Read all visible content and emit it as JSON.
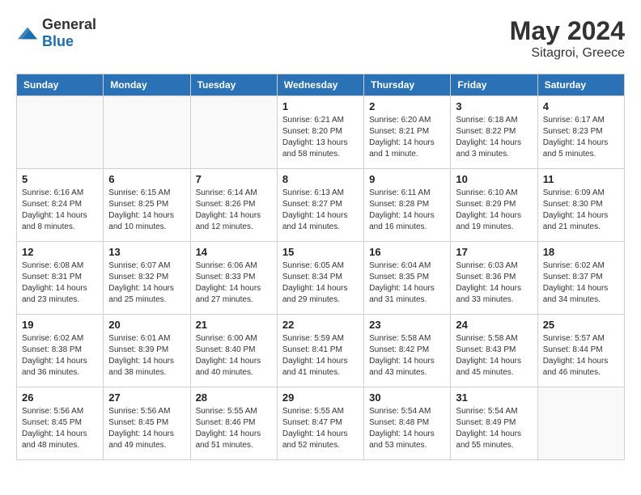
{
  "header": {
    "logo_general": "General",
    "logo_blue": "Blue",
    "month": "May 2024",
    "location": "Sitagroi, Greece"
  },
  "days_of_week": [
    "Sunday",
    "Monday",
    "Tuesday",
    "Wednesday",
    "Thursday",
    "Friday",
    "Saturday"
  ],
  "weeks": [
    [
      {
        "day": "",
        "sunrise": "",
        "sunset": "",
        "daylight": "",
        "empty": true
      },
      {
        "day": "",
        "sunrise": "",
        "sunset": "",
        "daylight": "",
        "empty": true
      },
      {
        "day": "",
        "sunrise": "",
        "sunset": "",
        "daylight": "",
        "empty": true
      },
      {
        "day": "1",
        "sunrise": "Sunrise: 6:21 AM",
        "sunset": "Sunset: 8:20 PM",
        "daylight": "Daylight: 13 hours and 58 minutes."
      },
      {
        "day": "2",
        "sunrise": "Sunrise: 6:20 AM",
        "sunset": "Sunset: 8:21 PM",
        "daylight": "Daylight: 14 hours and 1 minute."
      },
      {
        "day": "3",
        "sunrise": "Sunrise: 6:18 AM",
        "sunset": "Sunset: 8:22 PM",
        "daylight": "Daylight: 14 hours and 3 minutes."
      },
      {
        "day": "4",
        "sunrise": "Sunrise: 6:17 AM",
        "sunset": "Sunset: 8:23 PM",
        "daylight": "Daylight: 14 hours and 5 minutes."
      }
    ],
    [
      {
        "day": "5",
        "sunrise": "Sunrise: 6:16 AM",
        "sunset": "Sunset: 8:24 PM",
        "daylight": "Daylight: 14 hours and 8 minutes."
      },
      {
        "day": "6",
        "sunrise": "Sunrise: 6:15 AM",
        "sunset": "Sunset: 8:25 PM",
        "daylight": "Daylight: 14 hours and 10 minutes."
      },
      {
        "day": "7",
        "sunrise": "Sunrise: 6:14 AM",
        "sunset": "Sunset: 8:26 PM",
        "daylight": "Daylight: 14 hours and 12 minutes."
      },
      {
        "day": "8",
        "sunrise": "Sunrise: 6:13 AM",
        "sunset": "Sunset: 8:27 PM",
        "daylight": "Daylight: 14 hours and 14 minutes."
      },
      {
        "day": "9",
        "sunrise": "Sunrise: 6:11 AM",
        "sunset": "Sunset: 8:28 PM",
        "daylight": "Daylight: 14 hours and 16 minutes."
      },
      {
        "day": "10",
        "sunrise": "Sunrise: 6:10 AM",
        "sunset": "Sunset: 8:29 PM",
        "daylight": "Daylight: 14 hours and 19 minutes."
      },
      {
        "day": "11",
        "sunrise": "Sunrise: 6:09 AM",
        "sunset": "Sunset: 8:30 PM",
        "daylight": "Daylight: 14 hours and 21 minutes."
      }
    ],
    [
      {
        "day": "12",
        "sunrise": "Sunrise: 6:08 AM",
        "sunset": "Sunset: 8:31 PM",
        "daylight": "Daylight: 14 hours and 23 minutes."
      },
      {
        "day": "13",
        "sunrise": "Sunrise: 6:07 AM",
        "sunset": "Sunset: 8:32 PM",
        "daylight": "Daylight: 14 hours and 25 minutes."
      },
      {
        "day": "14",
        "sunrise": "Sunrise: 6:06 AM",
        "sunset": "Sunset: 8:33 PM",
        "daylight": "Daylight: 14 hours and 27 minutes."
      },
      {
        "day": "15",
        "sunrise": "Sunrise: 6:05 AM",
        "sunset": "Sunset: 8:34 PM",
        "daylight": "Daylight: 14 hours and 29 minutes."
      },
      {
        "day": "16",
        "sunrise": "Sunrise: 6:04 AM",
        "sunset": "Sunset: 8:35 PM",
        "daylight": "Daylight: 14 hours and 31 minutes."
      },
      {
        "day": "17",
        "sunrise": "Sunrise: 6:03 AM",
        "sunset": "Sunset: 8:36 PM",
        "daylight": "Daylight: 14 hours and 33 minutes."
      },
      {
        "day": "18",
        "sunrise": "Sunrise: 6:02 AM",
        "sunset": "Sunset: 8:37 PM",
        "daylight": "Daylight: 14 hours and 34 minutes."
      }
    ],
    [
      {
        "day": "19",
        "sunrise": "Sunrise: 6:02 AM",
        "sunset": "Sunset: 8:38 PM",
        "daylight": "Daylight: 14 hours and 36 minutes."
      },
      {
        "day": "20",
        "sunrise": "Sunrise: 6:01 AM",
        "sunset": "Sunset: 8:39 PM",
        "daylight": "Daylight: 14 hours and 38 minutes."
      },
      {
        "day": "21",
        "sunrise": "Sunrise: 6:00 AM",
        "sunset": "Sunset: 8:40 PM",
        "daylight": "Daylight: 14 hours and 40 minutes."
      },
      {
        "day": "22",
        "sunrise": "Sunrise: 5:59 AM",
        "sunset": "Sunset: 8:41 PM",
        "daylight": "Daylight: 14 hours and 41 minutes."
      },
      {
        "day": "23",
        "sunrise": "Sunrise: 5:58 AM",
        "sunset": "Sunset: 8:42 PM",
        "daylight": "Daylight: 14 hours and 43 minutes."
      },
      {
        "day": "24",
        "sunrise": "Sunrise: 5:58 AM",
        "sunset": "Sunset: 8:43 PM",
        "daylight": "Daylight: 14 hours and 45 minutes."
      },
      {
        "day": "25",
        "sunrise": "Sunrise: 5:57 AM",
        "sunset": "Sunset: 8:44 PM",
        "daylight": "Daylight: 14 hours and 46 minutes."
      }
    ],
    [
      {
        "day": "26",
        "sunrise": "Sunrise: 5:56 AM",
        "sunset": "Sunset: 8:45 PM",
        "daylight": "Daylight: 14 hours and 48 minutes."
      },
      {
        "day": "27",
        "sunrise": "Sunrise: 5:56 AM",
        "sunset": "Sunset: 8:45 PM",
        "daylight": "Daylight: 14 hours and 49 minutes."
      },
      {
        "day": "28",
        "sunrise": "Sunrise: 5:55 AM",
        "sunset": "Sunset: 8:46 PM",
        "daylight": "Daylight: 14 hours and 51 minutes."
      },
      {
        "day": "29",
        "sunrise": "Sunrise: 5:55 AM",
        "sunset": "Sunset: 8:47 PM",
        "daylight": "Daylight: 14 hours and 52 minutes."
      },
      {
        "day": "30",
        "sunrise": "Sunrise: 5:54 AM",
        "sunset": "Sunset: 8:48 PM",
        "daylight": "Daylight: 14 hours and 53 minutes."
      },
      {
        "day": "31",
        "sunrise": "Sunrise: 5:54 AM",
        "sunset": "Sunset: 8:49 PM",
        "daylight": "Daylight: 14 hours and 55 minutes."
      },
      {
        "day": "",
        "sunrise": "",
        "sunset": "",
        "daylight": "",
        "empty": true
      }
    ]
  ]
}
